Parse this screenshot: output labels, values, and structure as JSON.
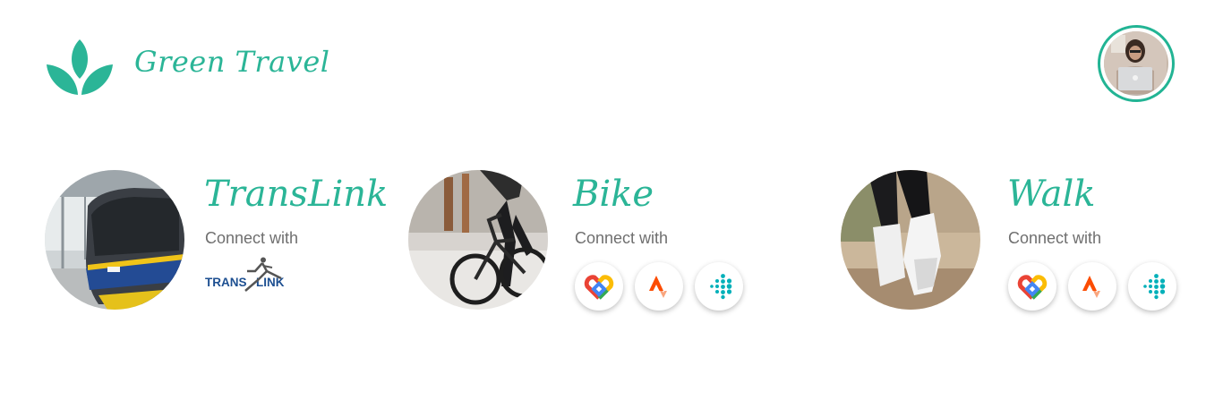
{
  "app": {
    "title": "Green Travel",
    "brand_color": "#2bb597"
  },
  "header": {
    "logo_icon": "leaf-logo-icon",
    "avatar_icon": "user-avatar"
  },
  "cards": [
    {
      "title": "TransLink",
      "subtitle": "Connect with",
      "provider_logo": {
        "word1": "TRANS",
        "word2": "LINK"
      }
    },
    {
      "title": "Bike",
      "subtitle": "Connect with",
      "providers": [
        "google-fit-icon",
        "strava-icon",
        "fitbit-icon"
      ]
    },
    {
      "title": "Walk",
      "subtitle": "Connect with",
      "providers": [
        "google-fit-icon",
        "strava-icon",
        "fitbit-icon"
      ]
    }
  ]
}
